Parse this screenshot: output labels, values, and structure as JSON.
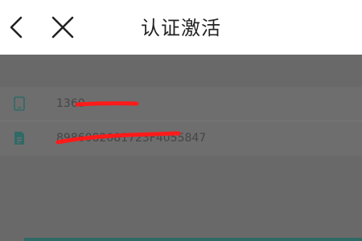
{
  "header": {
    "title": "认证激活",
    "back_icon": "chevron-left-icon",
    "close_icon": "close-icon"
  },
  "rows": [
    {
      "icon": "phone-icon",
      "value": "1360"
    },
    {
      "icon": "sim-card-icon",
      "value": "8986082081723F4055847"
    }
  ],
  "colors": {
    "accent": "#2f6a66",
    "redaction": "#ff1a1a",
    "overlay": "#696969"
  }
}
